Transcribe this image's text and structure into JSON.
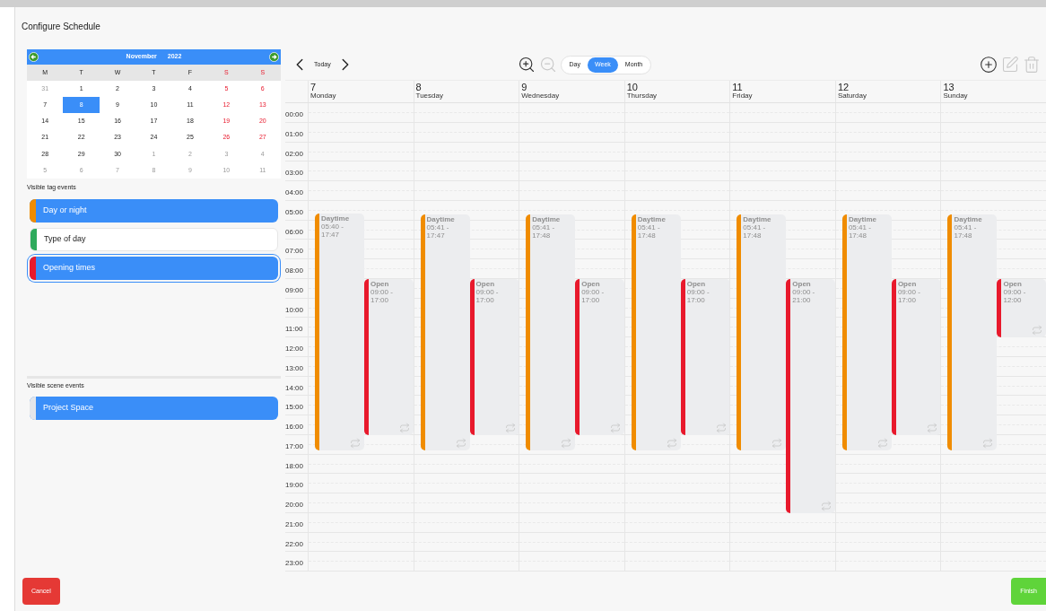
{
  "window": {
    "title": "Configure Schedule"
  },
  "calendar": {
    "month": "November",
    "year": "2022",
    "weekdays": [
      "M",
      "T",
      "W",
      "T",
      "F",
      "S",
      "S"
    ],
    "weeks": [
      [
        {
          "day": "31",
          "muted": true,
          "selected": false
        },
        {
          "day": "1",
          "muted": false,
          "selected": false
        },
        {
          "day": "2",
          "muted": false,
          "selected": false
        },
        {
          "day": "3",
          "muted": false,
          "selected": false
        },
        {
          "day": "4",
          "muted": false,
          "selected": false
        },
        {
          "day": "5",
          "muted": false,
          "selected": false
        },
        {
          "day": "6",
          "muted": false,
          "selected": false
        }
      ],
      [
        {
          "day": "7",
          "muted": false,
          "selected": false
        },
        {
          "day": "8",
          "muted": false,
          "selected": true
        },
        {
          "day": "9",
          "muted": false,
          "selected": false
        },
        {
          "day": "10",
          "muted": false,
          "selected": false
        },
        {
          "day": "11",
          "muted": false,
          "selected": false
        },
        {
          "day": "12",
          "muted": false,
          "selected": false
        },
        {
          "day": "13",
          "muted": false,
          "selected": false
        }
      ],
      [
        {
          "day": "14",
          "muted": false,
          "selected": false
        },
        {
          "day": "15",
          "muted": false,
          "selected": false
        },
        {
          "day": "16",
          "muted": false,
          "selected": false
        },
        {
          "day": "17",
          "muted": false,
          "selected": false
        },
        {
          "day": "18",
          "muted": false,
          "selected": false
        },
        {
          "day": "19",
          "muted": false,
          "selected": false
        },
        {
          "day": "20",
          "muted": false,
          "selected": false
        }
      ],
      [
        {
          "day": "21",
          "muted": false,
          "selected": false
        },
        {
          "day": "22",
          "muted": false,
          "selected": false
        },
        {
          "day": "23",
          "muted": false,
          "selected": false
        },
        {
          "day": "24",
          "muted": false,
          "selected": false
        },
        {
          "day": "25",
          "muted": false,
          "selected": false
        },
        {
          "day": "26",
          "muted": false,
          "selected": false
        },
        {
          "day": "27",
          "muted": false,
          "selected": false
        }
      ],
      [
        {
          "day": "28",
          "muted": false,
          "selected": false
        },
        {
          "day": "29",
          "muted": false,
          "selected": false
        },
        {
          "day": "30",
          "muted": false,
          "selected": false
        },
        {
          "day": "1",
          "muted": true,
          "selected": false
        },
        {
          "day": "2",
          "muted": true,
          "selected": false
        },
        {
          "day": "3",
          "muted": true,
          "selected": false
        },
        {
          "day": "4",
          "muted": true,
          "selected": false
        }
      ],
      [
        {
          "day": "5",
          "muted": true,
          "selected": false
        },
        {
          "day": "6",
          "muted": true,
          "selected": false
        },
        {
          "day": "7",
          "muted": true,
          "selected": false
        },
        {
          "day": "8",
          "muted": true,
          "selected": false
        },
        {
          "day": "9",
          "muted": true,
          "selected": false
        },
        {
          "day": "10",
          "muted": true,
          "selected": false
        },
        {
          "day": "11",
          "muted": true,
          "selected": false
        }
      ]
    ]
  },
  "tag_events": {
    "label": "Visible tag events",
    "items": [
      {
        "name": "Day or night",
        "color": "#f08c00",
        "selected": true,
        "focused": false
      },
      {
        "name": "Type of day",
        "color": "#2eaa5c",
        "selected": false,
        "focused": false
      },
      {
        "name": "Opening times",
        "color": "#e8192c",
        "selected": true,
        "focused": true
      }
    ]
  },
  "scene_events": {
    "label": "Visible scene events",
    "items": [
      {
        "name": "Project Space",
        "color": "#e4e6ea",
        "selected": true,
        "focused": false
      }
    ]
  },
  "toolbar": {
    "today": "Today",
    "views": [
      {
        "label": "Day",
        "selected": false
      },
      {
        "label": "Week",
        "selected": true
      },
      {
        "label": "Month",
        "selected": false
      }
    ],
    "zoom": [
      {
        "kind": "in",
        "disabled": false
      },
      {
        "kind": "out",
        "disabled": true
      }
    ],
    "actions": [
      {
        "kind": "add",
        "disabled": false
      },
      {
        "kind": "edit",
        "disabled": true
      },
      {
        "kind": "delete",
        "disabled": true
      }
    ]
  },
  "hours": [
    "00:00",
    "01:00",
    "02:00",
    "03:00",
    "04:00",
    "05:00",
    "06:00",
    "07:00",
    "08:00",
    "09:00",
    "10:00",
    "11:00",
    "12:00",
    "13:00",
    "14:00",
    "15:00",
    "16:00",
    "17:00",
    "18:00",
    "19:00",
    "20:00",
    "21:00",
    "22:00",
    "23:00"
  ],
  "days": [
    {
      "date": "7",
      "weekday": "Monday",
      "events": [
        {
          "kind": "daytime",
          "title": "Daytime",
          "time": "05:40 - 17:47",
          "color": "#f08c00"
        },
        {
          "kind": "open",
          "title": "Open",
          "time": "09:00 - 17:00",
          "color": "#e8192c"
        }
      ]
    },
    {
      "date": "8",
      "weekday": "Tuesday",
      "events": [
        {
          "kind": "daytime",
          "title": "Daytime",
          "time": "05:41 - 17:47",
          "color": "#f08c00"
        },
        {
          "kind": "open",
          "title": "Open",
          "time": "09:00 - 17:00",
          "color": "#e8192c"
        }
      ]
    },
    {
      "date": "9",
      "weekday": "Wednesday",
      "events": [
        {
          "kind": "daytime",
          "title": "Daytime",
          "time": "05:41 - 17:48",
          "color": "#f08c00"
        },
        {
          "kind": "open",
          "title": "Open",
          "time": "09:00 - 17:00",
          "color": "#e8192c"
        }
      ]
    },
    {
      "date": "10",
      "weekday": "Thursday",
      "events": [
        {
          "kind": "daytime",
          "title": "Daytime",
          "time": "05:41 - 17:48",
          "color": "#f08c00"
        },
        {
          "kind": "open",
          "title": "Open",
          "time": "09:00 - 17:00",
          "color": "#e8192c"
        }
      ]
    },
    {
      "date": "11",
      "weekday": "Friday",
      "events": [
        {
          "kind": "daytime",
          "title": "Daytime",
          "time": "05:41 - 17:48",
          "color": "#f08c00"
        },
        {
          "kind": "open",
          "title": "Open",
          "time": "09:00 - 21:00",
          "color": "#e8192c"
        }
      ]
    },
    {
      "date": "12",
      "weekday": "Saturday",
      "events": [
        {
          "kind": "daytime",
          "title": "Daytime",
          "time": "05:41 - 17:48",
          "color": "#f08c00"
        },
        {
          "kind": "open",
          "title": "Open",
          "time": "09:00 - 17:00",
          "color": "#e8192c"
        }
      ]
    },
    {
      "date": "13",
      "weekday": "Sunday",
      "events": [
        {
          "kind": "daytime",
          "title": "Daytime",
          "time": "05:41 - 17:48",
          "color": "#f08c00"
        },
        {
          "kind": "open",
          "title": "Open",
          "time": "09:00 - 12:00",
          "color": "#e8192c"
        }
      ]
    }
  ],
  "buttons": {
    "cancel": "Cancel",
    "finish": "Finish"
  }
}
